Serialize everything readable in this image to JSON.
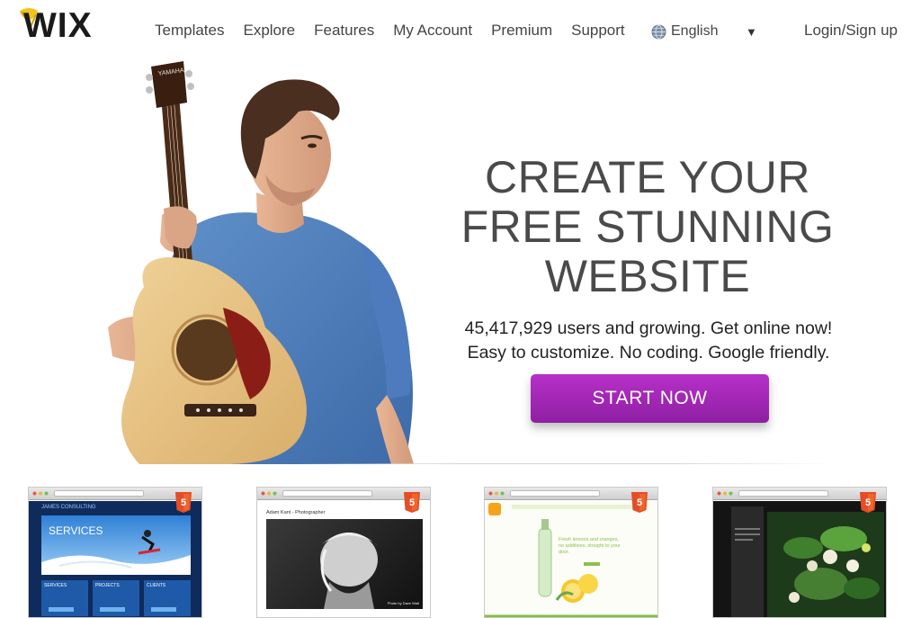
{
  "header": {
    "logo_text": "WIX",
    "nav": [
      "Templates",
      "Explore",
      "Features",
      "My Account",
      "Premium",
      "Support"
    ],
    "language": "English",
    "login": "Login/Sign up"
  },
  "hero": {
    "headline": [
      "CREATE YOUR",
      "FREE STUNNING",
      "WEBSITE"
    ],
    "tagline": [
      "45,417,929 users and growing. Get online now!",
      "Easy to customize. No coding. Google friendly."
    ],
    "cta": "START NOW",
    "guitar_brand": "YAMAHA"
  },
  "templates": [
    {
      "name": "business",
      "brand": "JAMES CONSULTING",
      "banner": "SERVICES",
      "boxes": [
        "SERVICES",
        "PROJECTS",
        "CLIENTS"
      ]
    },
    {
      "name": "photographer",
      "title": "Adam Kant - Photographer",
      "caption": "Photo by Dave Walt"
    },
    {
      "name": "drink",
      "tagline": "Fresh lemons and oranges, no additives, straight to your door."
    },
    {
      "name": "restaurant"
    }
  ],
  "colors": {
    "cta": "#a326b8",
    "text": "#4a4a4a",
    "logo_yellow": "#f4c21b"
  }
}
